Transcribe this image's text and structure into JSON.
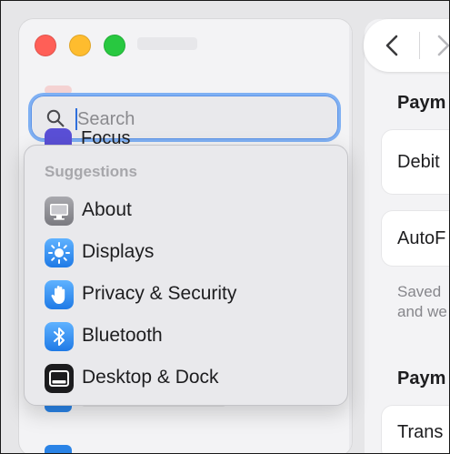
{
  "search": {
    "placeholder": "Search",
    "value": ""
  },
  "sidebar": {
    "partially_hidden_item": "Focus"
  },
  "suggestions": {
    "heading": "Suggestions",
    "items": [
      {
        "label": "About",
        "icon": "about-display-icon",
        "color": "#8e8e93"
      },
      {
        "label": "Displays",
        "icon": "displays-sun-icon",
        "color": "#2f8cf3"
      },
      {
        "label": "Privacy & Security",
        "icon": "privacy-hand-icon",
        "color": "#2f8cf3"
      },
      {
        "label": "Bluetooth",
        "icon": "bluetooth-icon",
        "color": "#2f8cf3"
      },
      {
        "label": "Desktop & Dock",
        "icon": "desktop-dock-icon",
        "color": "#1d1d1f"
      }
    ]
  },
  "right_pane": {
    "section1_title": "Paym",
    "card1_label": "Debit",
    "card2_label": "AutoF",
    "desc_line1": "Saved",
    "desc_line2": "and we",
    "section2_title": "Paym",
    "card3_label": "Trans"
  },
  "colors": {
    "accent_focus_ring": "#7fb0f3",
    "close": "#ff5f57",
    "minimize": "#febc2e",
    "zoom": "#28c840"
  }
}
